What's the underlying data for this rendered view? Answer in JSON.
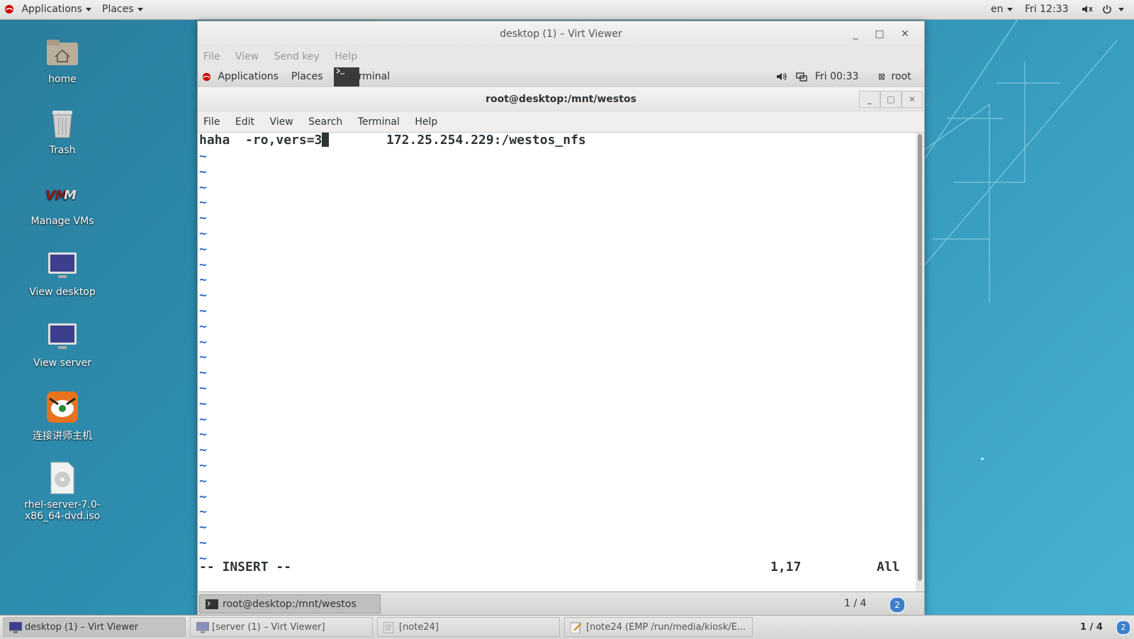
{
  "host_topbar": {
    "applications": "Applications",
    "places": "Places",
    "language": "en",
    "clock": "Fri 12:33"
  },
  "desktop_icons": [
    {
      "label": "home",
      "icon": "home-folder-icon"
    },
    {
      "label": "Trash",
      "icon": "trash-icon"
    },
    {
      "label": "Manage VMs",
      "icon": "vmm-icon"
    },
    {
      "label": "View desktop",
      "icon": "monitor-icon"
    },
    {
      "label": "View server",
      "icon": "monitor-icon"
    },
    {
      "label": "连接讲师主机",
      "icon": "tiger-app-icon"
    },
    {
      "label": "rhel-server-7.0-x86_64-dvd.iso",
      "icon": "disc-image-icon"
    }
  ],
  "virt_viewer": {
    "title": "desktop (1) – Virt Viewer",
    "menu": [
      "File",
      "View",
      "Send key",
      "Help"
    ]
  },
  "guest_topbar": {
    "applications": "Applications",
    "places": "Places",
    "terminal_tab": "Terminal",
    "clock": "Fri 00:33",
    "user": "root"
  },
  "terminal": {
    "title": "root@desktop:/mnt/westos",
    "menu": [
      "File",
      "Edit",
      "View",
      "Search",
      "Terminal",
      "Help"
    ],
    "line1_left": "haha  -ro,vers=3",
    "line1_right": "172.25.254.229:/westos_nfs",
    "tilde": "~",
    "mode": "-- INSERT --",
    "position": "1,17",
    "scroll": "All"
  },
  "guest_taskbar": {
    "task": "root@desktop:/mnt/westos",
    "workspace": "1 / 4",
    "badge": "2"
  },
  "host_taskbar": {
    "tasks": [
      "desktop (1) – Virt Viewer",
      "[server (1) – Virt Viewer]",
      "[note24]",
      "[note24 (EMP /run/media/kiosk/E..."
    ],
    "workspace": "1 / 4",
    "badge": "2"
  },
  "colors": {
    "desktop_bg": "#2f8fb0",
    "tilde": "#2e6dd0",
    "redhat": "#cc0000"
  }
}
